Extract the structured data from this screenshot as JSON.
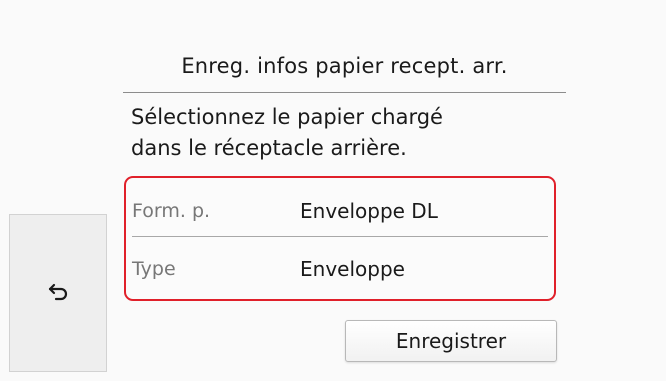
{
  "header": {
    "title": "Enreg. infos papier recept. arr."
  },
  "instruction": {
    "line1": "Sélectionnez le papier chargé",
    "line2": "dans le réceptacle arrière."
  },
  "settings": {
    "paper_size": {
      "label": "Form. p.",
      "value": "Enveloppe DL"
    },
    "paper_type": {
      "label": "Type",
      "value": "Enveloppe"
    }
  },
  "actions": {
    "register_label": "Enregistrer",
    "back_icon": "back-arrow"
  },
  "colors": {
    "highlight_border": "#e0202a",
    "background": "#fafafa",
    "side_panel": "#eeeeee"
  }
}
